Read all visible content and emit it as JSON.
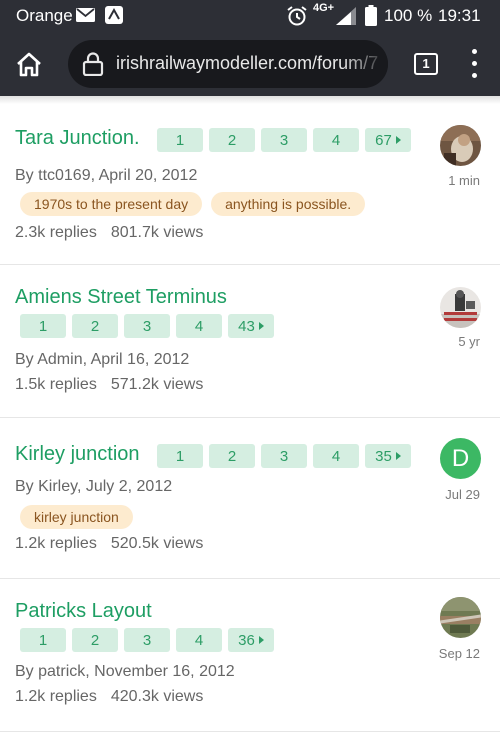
{
  "status_bar": {
    "carrier": "Orange",
    "network": "4G+",
    "battery": "100 %",
    "time": "19:31"
  },
  "browser": {
    "url": "irishrailwaymodeller.com/forum/7",
    "tab_count": "1"
  },
  "topics": [
    {
      "title": "Tara Junction.",
      "pages": [
        "1",
        "2",
        "3",
        "4",
        "67"
      ],
      "byline": "By ttc0169, April 20, 2012",
      "tags": [
        "1970s to the present day",
        "anything is possible."
      ],
      "replies": "2.3k replies",
      "views": "801.7k views",
      "activity": "1 min",
      "avatar": "photo"
    },
    {
      "title": "Amiens Street Terminus",
      "pages": [
        "1",
        "2",
        "3",
        "4",
        "43"
      ],
      "byline": "By Admin, April 16, 2012",
      "tags": [],
      "replies": "1.5k replies",
      "views": "571.2k views",
      "activity": "5 yr",
      "avatar": "photo"
    },
    {
      "title": "Kirley junction",
      "pages": [
        "1",
        "2",
        "3",
        "4",
        "35"
      ],
      "byline": "By Kirley, July 2, 2012",
      "tags": [
        "kirley junction"
      ],
      "replies": "1.2k replies",
      "views": "520.5k views",
      "activity": "Jul 29",
      "avatar": "letter",
      "avatar_letter": "D"
    },
    {
      "title": "Patricks Layout",
      "pages": [
        "1",
        "2",
        "3",
        "4",
        "36"
      ],
      "byline": "By patrick, November 16, 2012",
      "tags": [],
      "replies": "1.2k replies",
      "views": "420.3k views",
      "activity": "Sep 12",
      "avatar": "photo"
    }
  ],
  "colors": {
    "title": "#1e9e63",
    "page_button": "#d5eee1",
    "tag": "#fdebcf",
    "letter_avatar": "#3cb864",
    "chrome": "#2d2f36"
  }
}
